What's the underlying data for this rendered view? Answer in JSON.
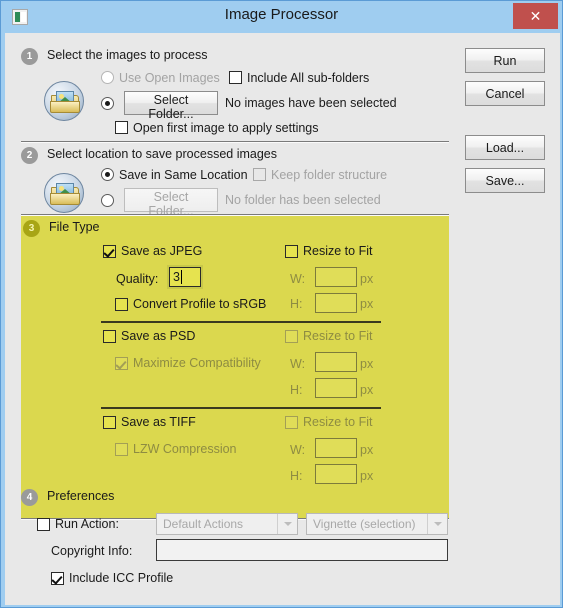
{
  "window": {
    "title": "Image Processor",
    "app_icon": "image-icon",
    "close_label": "✕"
  },
  "buttons": {
    "run": "Run",
    "cancel": "Cancel",
    "load": "Load...",
    "save": "Save..."
  },
  "step1": {
    "number": "1",
    "title": "Select the images to process",
    "use_open_images": "Use Open Images",
    "include_subfolders": "Include All sub-folders",
    "select_folder": "Select Folder...",
    "folder_status": "No images have been selected",
    "open_first_image": "Open first image to apply settings",
    "source_selected": "select_folder"
  },
  "step2": {
    "number": "2",
    "title": "Select location to save processed images",
    "save_same_location": "Save in Same Location",
    "keep_folder_structure": "Keep folder structure",
    "select_folder": "Select Folder...",
    "folder_status": "No folder has been selected",
    "destination_selected": "save_same_location"
  },
  "step3": {
    "number": "3",
    "title": "File Type",
    "jpeg": {
      "save_as": "Save as JPEG",
      "checked": true,
      "quality_label": "Quality:",
      "quality_value": "3",
      "convert_srgb": "Convert Profile to sRGB",
      "convert_srgb_checked": false,
      "resize_to_fit": "Resize to Fit",
      "resize_checked": false,
      "w_label": "W:",
      "w_value": "",
      "h_label": "H:",
      "h_value": "",
      "px": "px"
    },
    "psd": {
      "save_as": "Save as PSD",
      "checked": false,
      "maximize_compatibility": "Maximize Compatibility",
      "maximize_checked": true,
      "resize_to_fit": "Resize to Fit",
      "resize_checked": false,
      "w_label": "W:",
      "w_value": "",
      "h_label": "H:",
      "h_value": "",
      "px": "px"
    },
    "tiff": {
      "save_as": "Save as TIFF",
      "checked": false,
      "lzw_compression": "LZW Compression",
      "lzw_checked": false,
      "resize_to_fit": "Resize to Fit",
      "resize_checked": false,
      "w_label": "W:",
      "w_value": "",
      "h_label": "H:",
      "h_value": "",
      "px": "px"
    }
  },
  "step4": {
    "number": "4",
    "title": "Preferences",
    "run_action_label": "Run Action:",
    "run_action_checked": false,
    "action_set": "Default Actions",
    "action_name": "Vignette (selection)",
    "copyright_label": "Copyright Info:",
    "copyright_value": "",
    "include_icc": "Include ICC Profile",
    "include_icc_checked": true
  },
  "colors": {
    "titlebar": "#9fcdf0",
    "close_button": "#c0504d",
    "panel_highlight": "#dbd84e",
    "dialog_bg": "#e8e8e8"
  }
}
